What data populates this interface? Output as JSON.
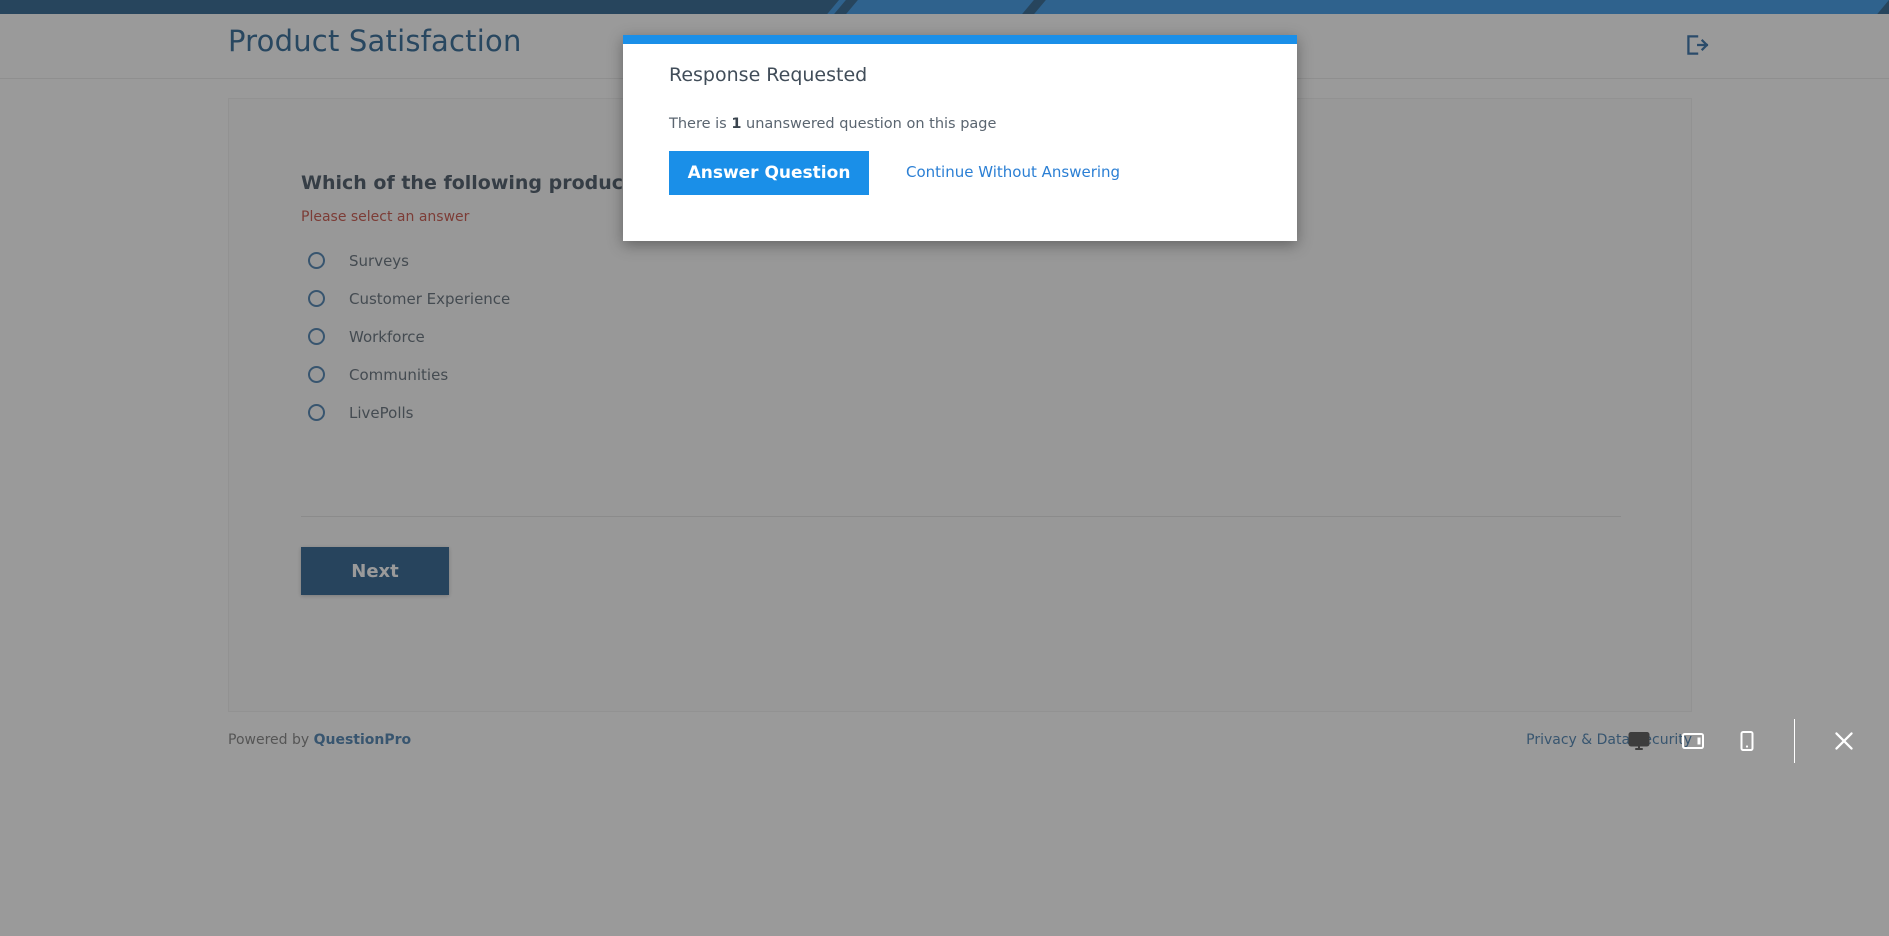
{
  "header": {
    "title": "Product Satisfaction",
    "logout_icon": "logout-icon"
  },
  "survey": {
    "question": "Which of the following product do you like the most?",
    "error": "Please select an answer",
    "options": [
      {
        "label": "Surveys",
        "selected": false
      },
      {
        "label": "Customer Experience",
        "selected": false
      },
      {
        "label": "Workforce",
        "selected": false
      },
      {
        "label": "Communities",
        "selected": false
      },
      {
        "label": "LivePolls",
        "selected": false
      }
    ],
    "next_label": "Next"
  },
  "footer": {
    "powered_by": "Powered by ",
    "brand": "QuestionPro",
    "privacy": "Privacy & Data Security"
  },
  "modal": {
    "title": "Response Requested",
    "message_before": "There is ",
    "message_count": "1",
    "message_after": " unanswered question on this page",
    "answer_label": "Answer Question",
    "continue_label": "Continue Without Answering",
    "accent_color": "#1a8fe8"
  },
  "device_toolbar": {
    "desktop_icon": "desktop-icon",
    "tablet_icon": "tablet-icon",
    "mobile_icon": "mobile-icon",
    "close_icon": "close-icon"
  },
  "colors": {
    "brand_dark_blue": "#0b4a7d",
    "brand_blue": "#1a8fe8",
    "title_blue": "#0d4f85",
    "error_red": "#c0392b",
    "link_blue": "#2f6ea5"
  }
}
